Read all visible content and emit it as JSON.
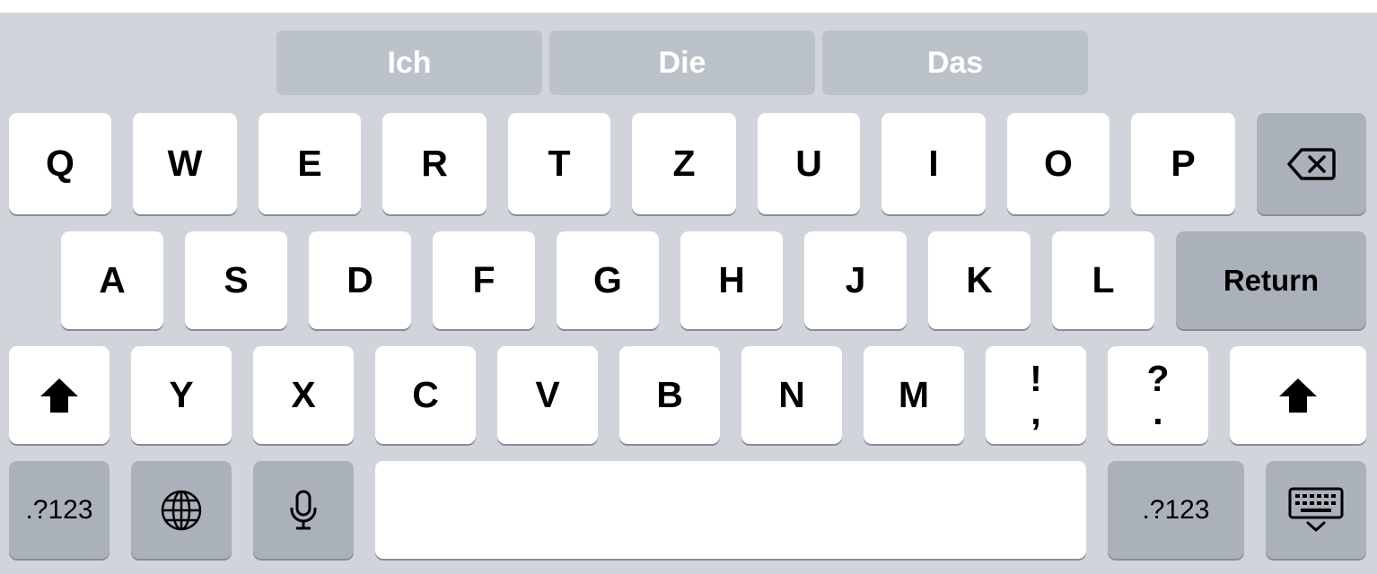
{
  "suggestions": [
    "Ich",
    "Die",
    "Das"
  ],
  "row1": [
    "Q",
    "W",
    "E",
    "R",
    "T",
    "Z",
    "U",
    "I",
    "O",
    "P"
  ],
  "row2": [
    "A",
    "S",
    "D",
    "F",
    "G",
    "H",
    "J",
    "K",
    "L"
  ],
  "row3": [
    "Y",
    "X",
    "C",
    "V",
    "B",
    "N",
    "M"
  ],
  "punct1": {
    "top": "!",
    "bottom": ","
  },
  "punct2": {
    "top": "?",
    "bottom": "."
  },
  "return_label": "Return",
  "numbers_label": ".?123",
  "icons": {
    "delete": "backspace-icon",
    "shift": "shift-icon",
    "globe": "globe-icon",
    "mic": "microphone-icon",
    "dismiss": "keyboard-dismiss-icon"
  },
  "colors": {
    "keyboard_bg": "#d1d4da",
    "key": "#ffffff",
    "function_key": "#abb1bb",
    "suggestion_bg": "#bcc2ca"
  }
}
